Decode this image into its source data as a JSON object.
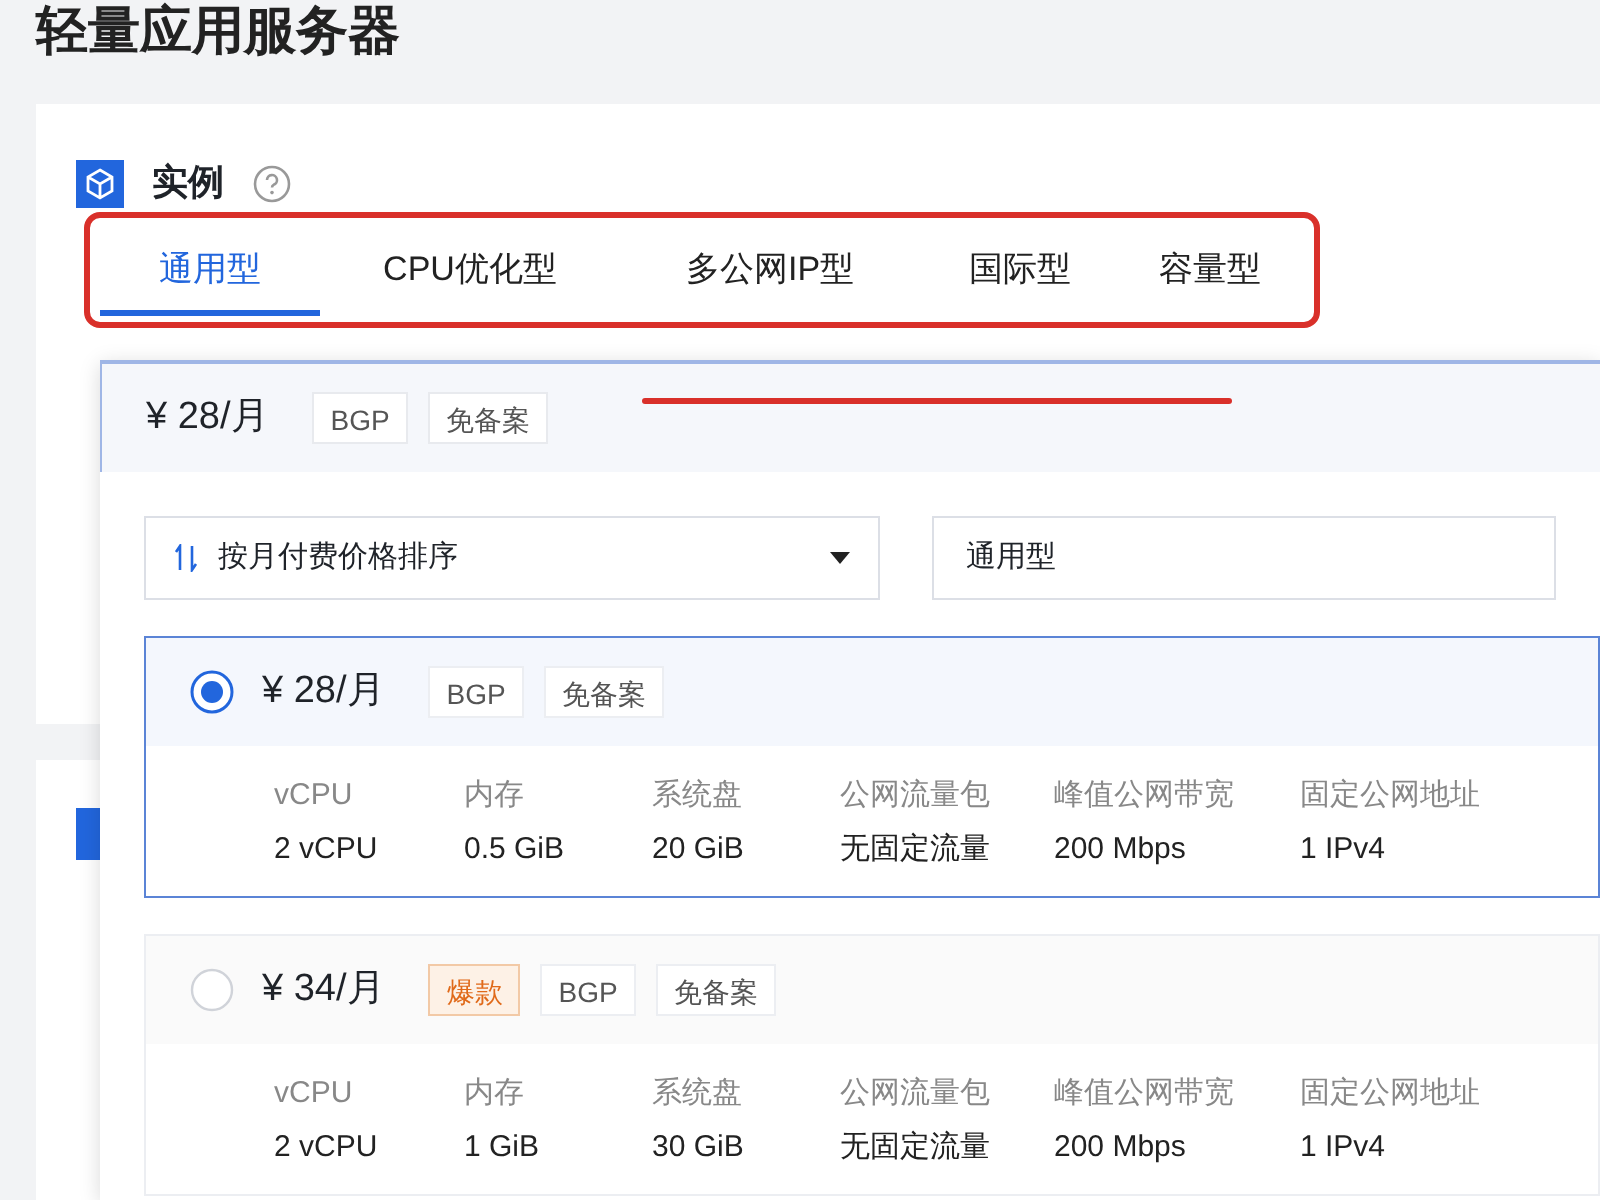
{
  "page": {
    "title": "轻量应用服务器"
  },
  "section": {
    "title": "实例",
    "tabs": [
      {
        "label": "通用型",
        "selected": true
      },
      {
        "label": "CPU优化型",
        "selected": false
      },
      {
        "label": "多公网IP型",
        "selected": false
      },
      {
        "label": "国际型",
        "selected": false
      },
      {
        "label": "容量型",
        "selected": false
      }
    ]
  },
  "dropdown": {
    "summary": {
      "price": "¥ 28/月",
      "tags": [
        "BGP",
        "免备案"
      ]
    },
    "sort_select": {
      "value": "按月付费价格排序"
    },
    "type_select": {
      "value": "通用型"
    },
    "plans": [
      {
        "selected": true,
        "price": "¥ 28/月",
        "tags": [
          {
            "label": "BGP",
            "kind": "plain"
          },
          {
            "label": "免备案",
            "kind": "plain"
          }
        ],
        "specs": [
          {
            "label": "vCPU",
            "value": "2 vCPU"
          },
          {
            "label": "内存",
            "value": "0.5 GiB"
          },
          {
            "label": "系统盘",
            "value": "20 GiB"
          },
          {
            "label": "公网流量包",
            "value": "无固定流量"
          },
          {
            "label": "峰值公网带宽",
            "value": "200 Mbps"
          },
          {
            "label": "固定公网地址",
            "value": "1 IPv4"
          }
        ]
      },
      {
        "selected": false,
        "price": "¥ 34/月",
        "tags": [
          {
            "label": "爆款",
            "kind": "hot"
          },
          {
            "label": "BGP",
            "kind": "plain"
          },
          {
            "label": "免备案",
            "kind": "plain"
          }
        ],
        "specs": [
          {
            "label": "vCPU",
            "value": "2 vCPU"
          },
          {
            "label": "内存",
            "value": "1 GiB"
          },
          {
            "label": "系统盘",
            "value": "30 GiB"
          },
          {
            "label": "公网流量包",
            "value": "无固定流量"
          },
          {
            "label": "峰值公网带宽",
            "value": "200 Mbps"
          },
          {
            "label": "固定公网地址",
            "value": "1 IPv4"
          }
        ]
      }
    ]
  }
}
